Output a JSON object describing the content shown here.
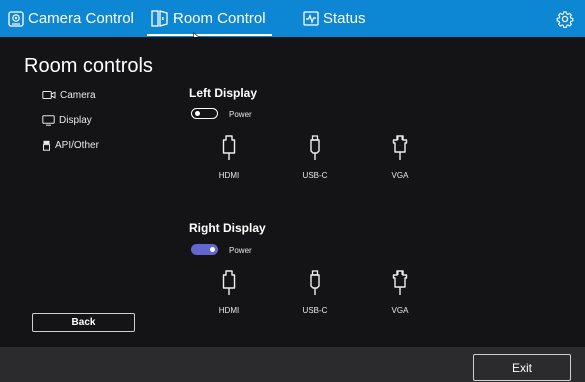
{
  "header": {
    "tabs": [
      {
        "label": "Camera Control",
        "icon": "camera-control-icon"
      },
      {
        "label": "Room Control",
        "icon": "room-control-icon",
        "active": true
      },
      {
        "label": "Status",
        "icon": "status-icon"
      }
    ],
    "settings_icon": "gear-icon"
  },
  "main": {
    "title": "Room controls",
    "nav": [
      {
        "label": "Camera",
        "icon": "camera-icon"
      },
      {
        "label": "Display",
        "icon": "monitor-icon"
      },
      {
        "label": "API/Other",
        "icon": "api-icon"
      }
    ],
    "back_label": "Back",
    "displays": [
      {
        "title": "Left Display",
        "power_label": "Power",
        "power_on": false,
        "ports": [
          "HDMI",
          "USB-C",
          "VGA"
        ]
      },
      {
        "title": "Right Display",
        "power_label": "Power",
        "power_on": true,
        "ports": [
          "HDMI",
          "USB-C",
          "VGA"
        ]
      }
    ]
  },
  "footer": {
    "exit_label": "Exit"
  },
  "colors": {
    "header_bg": "#0d86d4",
    "body_bg": "#141416",
    "footer_bg": "#2b2b2e",
    "toggle_on": "#6466cf"
  }
}
